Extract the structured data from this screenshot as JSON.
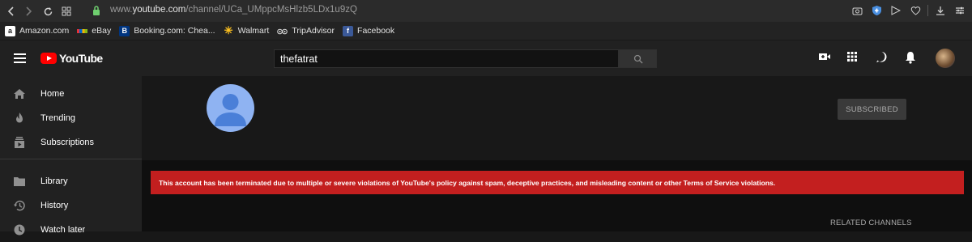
{
  "browser": {
    "url_prefix": "www.",
    "url_domain": "youtube.com",
    "url_path": "/channel/UCa_UMppcMsHlzb5LDx1u9zQ",
    "bookmarks": [
      {
        "label": "Amazon.com",
        "icon": "amazon-icon"
      },
      {
        "label": "eBay",
        "icon": "ebay-icon"
      },
      {
        "label": "Booking.com: Chea...",
        "icon": "booking-icon"
      },
      {
        "label": "Walmart",
        "icon": "walmart-icon"
      },
      {
        "label": "TripAdvisor",
        "icon": "tripadvisor-icon"
      },
      {
        "label": "Facebook",
        "icon": "facebook-icon"
      }
    ]
  },
  "header": {
    "logo_text": "YouTube",
    "search_value": "thefatrat"
  },
  "sidebar": {
    "items": [
      {
        "label": "Home",
        "icon": "home-icon"
      },
      {
        "label": "Trending",
        "icon": "trending-icon"
      },
      {
        "label": "Subscriptions",
        "icon": "subscriptions-icon"
      },
      {
        "label": "Library",
        "icon": "library-icon"
      },
      {
        "label": "History",
        "icon": "history-icon"
      },
      {
        "label": "Watch later",
        "icon": "watch-later-icon"
      }
    ]
  },
  "channel": {
    "subscribe_label": "SUBSCRIBED",
    "termination_message": "This account has been terminated due to multiple or severe violations of YouTube's policy against spam, deceptive practices, and misleading content or other Terms of Service violations.",
    "related_label": "RELATED CHANNELS"
  },
  "colors": {
    "alert_red": "#c31f1f",
    "yt_red": "#ff0000",
    "avatar_blue": "#8fb3f2"
  }
}
